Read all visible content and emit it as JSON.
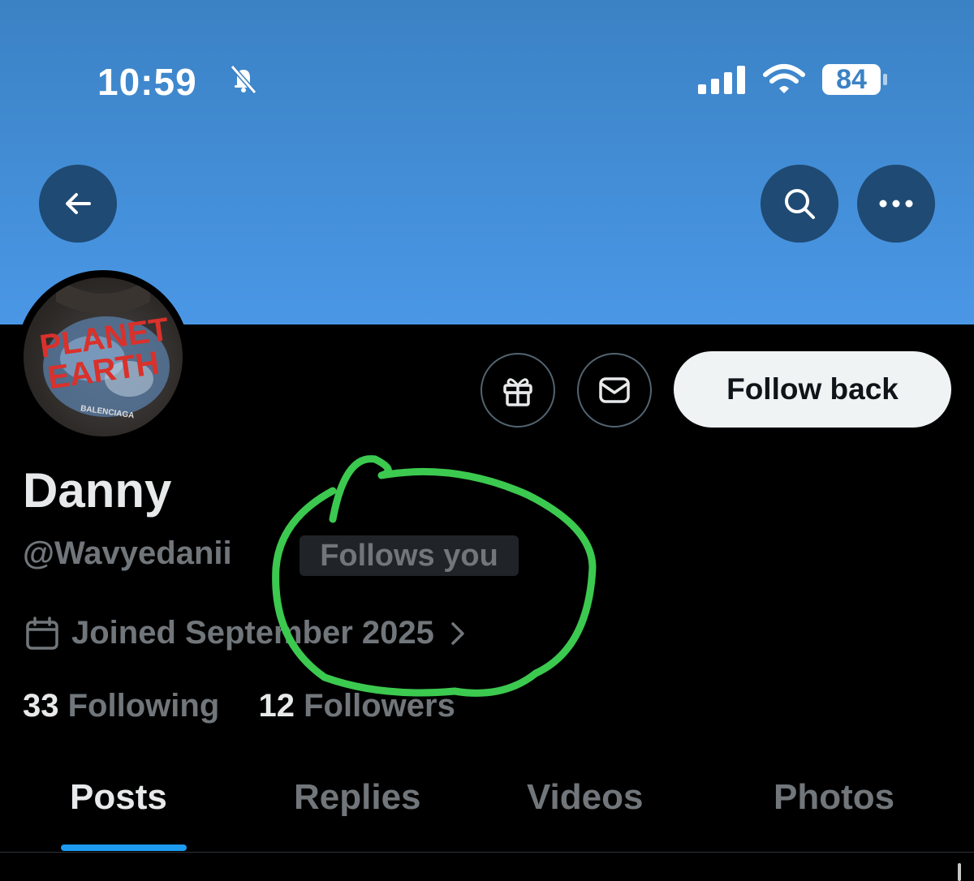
{
  "status_bar": {
    "time": "10:59",
    "battery": "84"
  },
  "profile": {
    "display_name": "Danny",
    "handle": "@Wavyedanii",
    "follows_you": "Follows you",
    "joined": "Joined September 2025",
    "following_count": "33",
    "following_label": "Following",
    "followers_count": "12",
    "followers_label": "Followers"
  },
  "avatar": {
    "line1": "PLANET",
    "line2": "EARTH",
    "brand": "BALENCIAGA"
  },
  "actions": {
    "follow_back": "Follow back"
  },
  "tabs": [
    {
      "label": "Posts",
      "active": true
    },
    {
      "label": "Replies"
    },
    {
      "label": "Videos"
    },
    {
      "label": "Photos"
    }
  ],
  "icons": {
    "back": "arrow-left-icon",
    "search": "search-icon",
    "more": "more-icon",
    "gift": "gift-icon",
    "message": "envelope-icon",
    "calendar": "calendar-icon",
    "chevron": "chevron-right-icon",
    "mute": "bell-slash-icon",
    "signal": "cellular-signal-icon",
    "wifi": "wifi-icon"
  },
  "colors": {
    "banner": "#4a97e6",
    "accent": "#1d9bf0",
    "annotation": "#3cc94f",
    "muted": "#71767b"
  }
}
